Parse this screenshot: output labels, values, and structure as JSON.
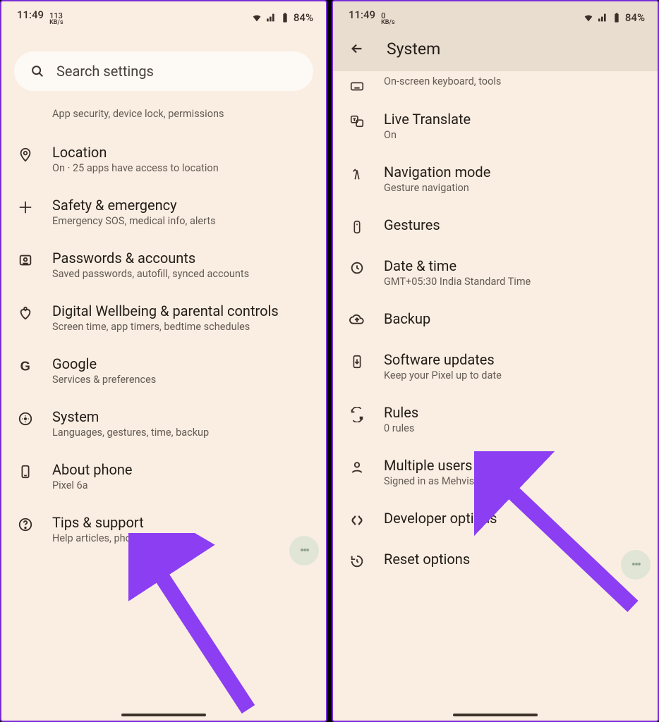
{
  "status": {
    "time": "11:49",
    "kbs1": "113",
    "kbs2": "0",
    "kbs_unit": "KB/s",
    "battery": "84%"
  },
  "left": {
    "search_placeholder": "Search settings",
    "prev_sub": "App security, device lock, permissions",
    "items": [
      {
        "key": "location",
        "title": "Location",
        "sub": "On · 25 apps have access to location"
      },
      {
        "key": "safety",
        "title": "Safety & emergency",
        "sub": "Emergency SOS, medical info, alerts"
      },
      {
        "key": "passwords",
        "title": "Passwords & accounts",
        "sub": "Saved passwords, autofill, synced accounts"
      },
      {
        "key": "wellbeing",
        "title": "Digital Wellbeing & parental controls",
        "sub": "Screen time, app timers, bedtime schedules"
      },
      {
        "key": "google",
        "title": "Google",
        "sub": "Services & preferences"
      },
      {
        "key": "system",
        "title": "System",
        "sub": "Languages, gestures, time, backup"
      },
      {
        "key": "about",
        "title": "About phone",
        "sub": "Pixel 6a"
      },
      {
        "key": "tips",
        "title": "Tips & support",
        "sub": "Help articles, phone & chat"
      }
    ]
  },
  "right": {
    "header_title": "System",
    "partial_sub": "On-screen keyboard, tools",
    "fab_b_bottom": 200,
    "items": [
      {
        "key": "livetranslate",
        "title": "Live Translate",
        "sub": "On"
      },
      {
        "key": "navmode",
        "title": "Navigation mode",
        "sub": "Gesture navigation"
      },
      {
        "key": "gestures",
        "title": "Gestures",
        "sub": ""
      },
      {
        "key": "datetime",
        "title": "Date & time",
        "sub": "GMT+05:30 India Standard Time"
      },
      {
        "key": "backup",
        "title": "Backup",
        "sub": ""
      },
      {
        "key": "software",
        "title": "Software updates",
        "sub": "Keep your Pixel up to date"
      },
      {
        "key": "rules",
        "title": "Rules",
        "sub": "0 rules"
      },
      {
        "key": "multiusers",
        "title": "Multiple users",
        "sub": "Signed in as Mehvish"
      },
      {
        "key": "devopts",
        "title": "Developer options",
        "sub": ""
      },
      {
        "key": "reset",
        "title": "Reset options",
        "sub": ""
      }
    ]
  }
}
